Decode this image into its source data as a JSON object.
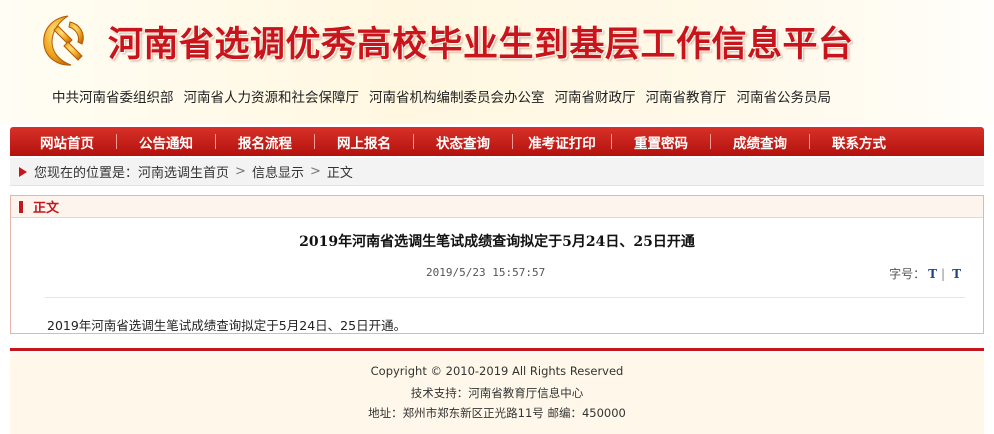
{
  "header": {
    "site_title": "河南省选调优秀高校毕业生到基层工作信息平台",
    "organizations": [
      "中共河南省委组织部",
      "河南省人力资源和社会保障厅",
      "河南省机构编制委员会办公室",
      "河南省财政厅",
      "河南省教育厅",
      "河南省公务员局"
    ],
    "emblem_icon": "party-emblem-icon",
    "title_color": "#c8141a"
  },
  "nav": {
    "items": [
      "网站首页",
      "公告通知",
      "报名流程",
      "网上报名",
      "状态查询",
      "准考证打印",
      "重置密码",
      "成绩查询",
      "联系方式"
    ],
    "bg_color": "#c4161c"
  },
  "breadcrumb": {
    "prefix": "您现在的位置是：",
    "items": [
      "河南选调生首页",
      "信息显示",
      "正文"
    ],
    "separator": ">"
  },
  "article": {
    "section_label": "正文",
    "title": "2019年河南省选调生笔试成绩查询拟定于5月24日、25日开通",
    "date": "2019/5/23 15:57:57",
    "font_size_label": "字号：",
    "font_large": "T",
    "font_small": "T",
    "body": "2019年河南省选调生笔试成绩查询拟定于5月24日、25日开通。"
  },
  "footer": {
    "copyright": "Copyright © 2010-2019 All Rights Reserved",
    "support": "技术支持：河南省教育厅信息中心",
    "address": "地址：郑州市郑东新区正光路11号 邮编：450000"
  }
}
